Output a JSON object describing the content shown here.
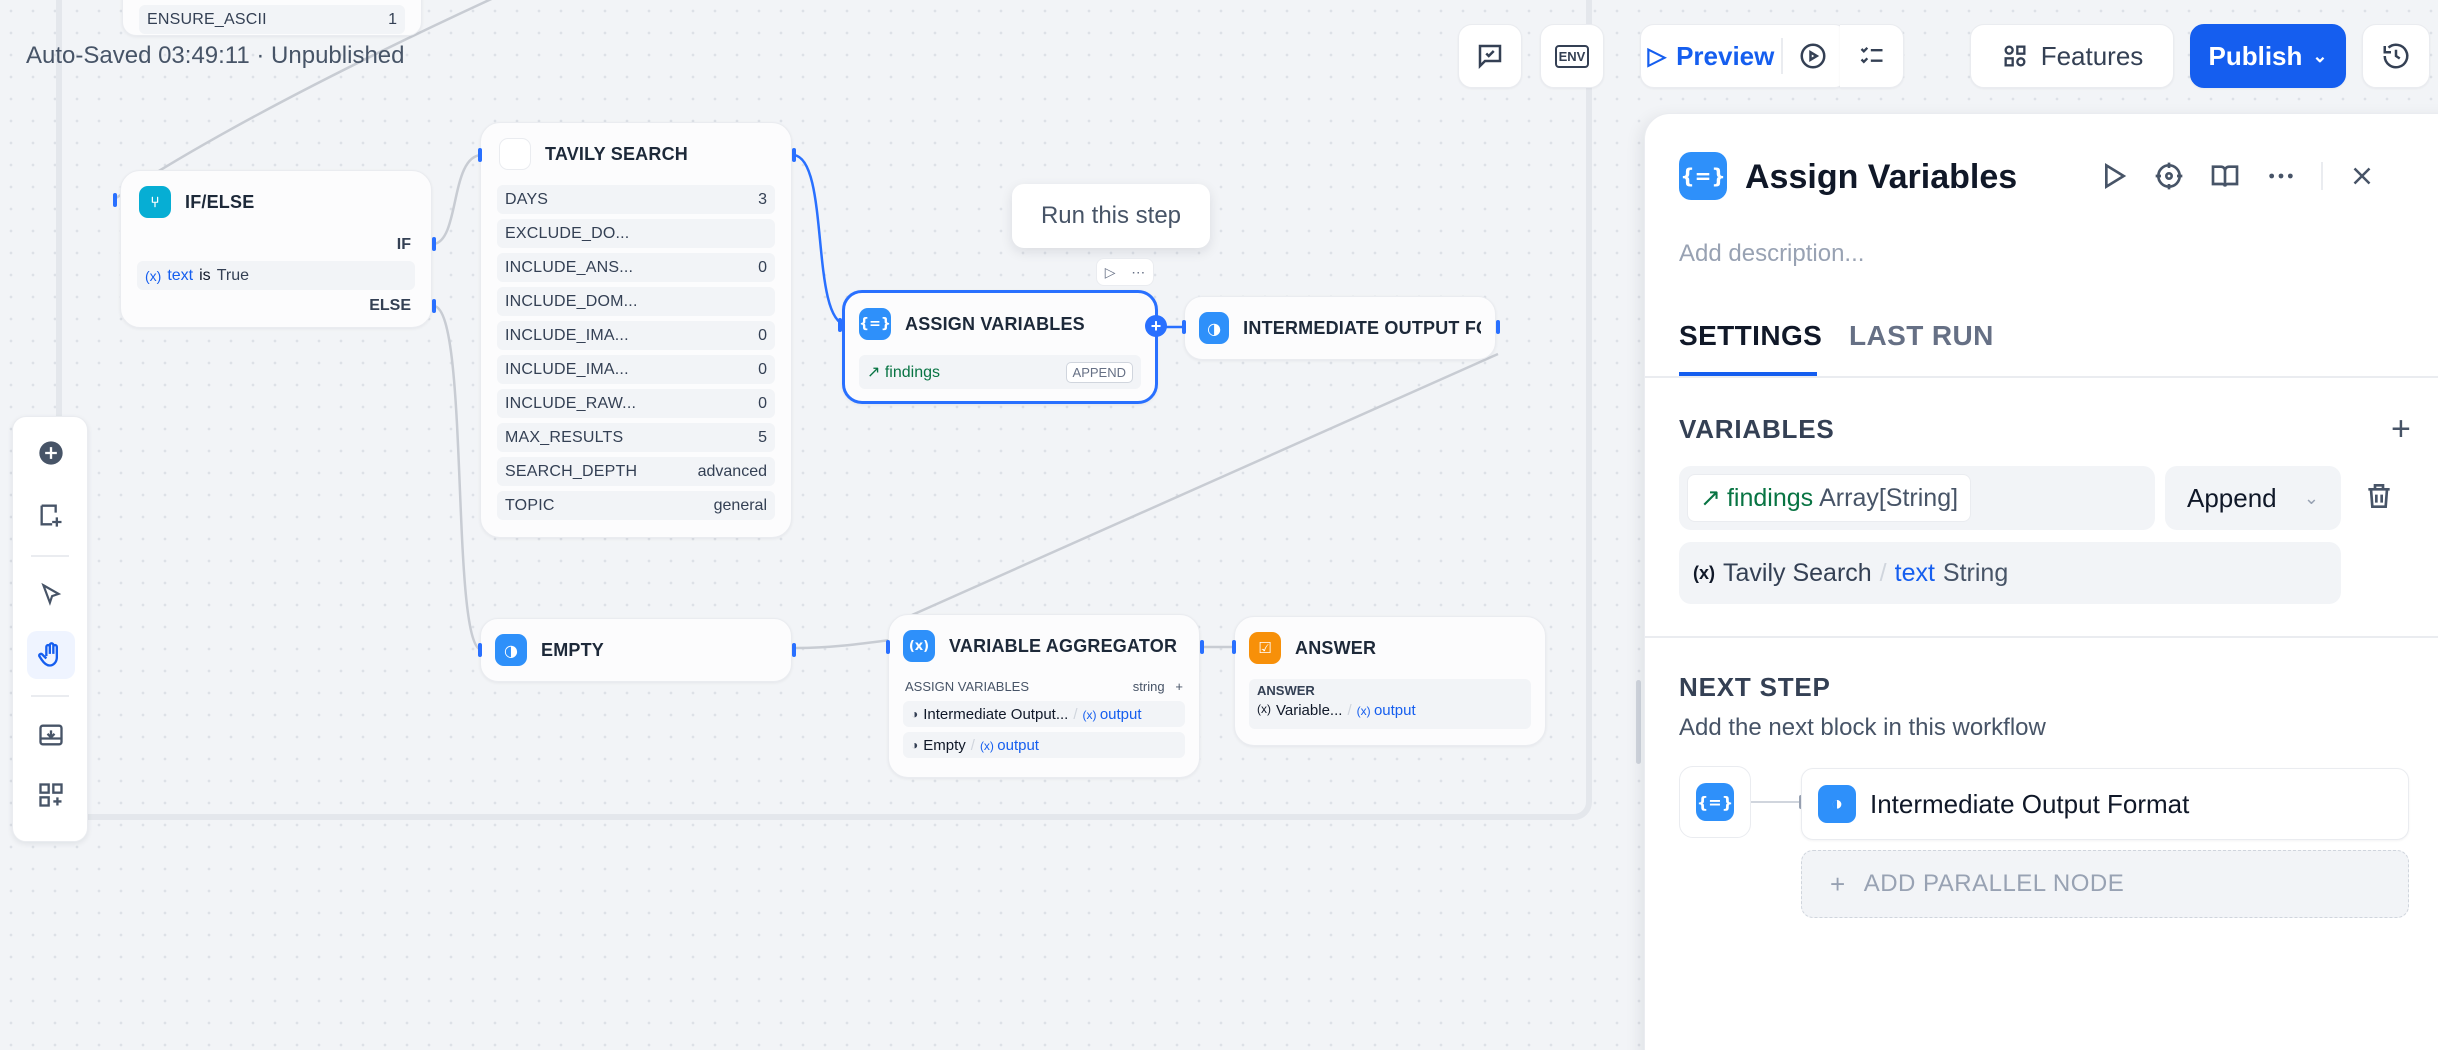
{
  "autosave": "Auto-Saved 03:49:11 · Unpublished",
  "topbar": {
    "preview": "Preview",
    "features": "Features",
    "publish": "Publish",
    "env": "ENV"
  },
  "tooltip": "Run this step",
  "nodes": {
    "top_stub": {
      "key": "ENSURE_ASCII",
      "value": "1"
    },
    "ifelse": {
      "title": "IF/ELSE",
      "if_label": "IF",
      "else_label": "ELSE",
      "cond_var": "text",
      "cond_op": "is",
      "cond_val": "True"
    },
    "tavily": {
      "title": "TAVILY SEARCH",
      "params": [
        {
          "k": "DAYS",
          "v": "3"
        },
        {
          "k": "EXCLUDE_DO...",
          "v": ""
        },
        {
          "k": "INCLUDE_ANS...",
          "v": "0"
        },
        {
          "k": "INCLUDE_DOM...",
          "v": ""
        },
        {
          "k": "INCLUDE_IMA...",
          "v": "0"
        },
        {
          "k": "INCLUDE_IMA...",
          "v": "0"
        },
        {
          "k": "INCLUDE_RAW...",
          "v": "0"
        },
        {
          "k": "MAX_RESULTS",
          "v": "5"
        },
        {
          "k": "SEARCH_DEPTH",
          "v": "advanced"
        },
        {
          "k": "TOPIC",
          "v": "general"
        }
      ]
    },
    "assign": {
      "title": "ASSIGN VARIABLES",
      "var": "findings",
      "mode": "APPEND"
    },
    "intermediate": {
      "title": "INTERMEDIATE OUTPUT FOI"
    },
    "empty": {
      "title": "EMPTY"
    },
    "aggregator": {
      "title": "VARIABLE AGGREGATOR",
      "group": "ASSIGN VARIABLES",
      "type": "string",
      "rows": [
        {
          "src": "Intermediate Output...",
          "var": "output"
        },
        {
          "src": "Empty",
          "var": "output"
        }
      ]
    },
    "answer": {
      "title": "ANSWER",
      "label": "ANSWER",
      "src": "Variable...",
      "var": "output"
    }
  },
  "panel": {
    "title": "Assign Variables",
    "description_placeholder": "Add description...",
    "tabs": [
      "SETTINGS",
      "LAST RUN"
    ],
    "variables_title": "VARIABLES",
    "var_name": "findings",
    "var_type": "Array[String]",
    "mode": "Append",
    "source_node": "Tavily Search",
    "source_var": "text",
    "source_type": "String",
    "next_title": "NEXT STEP",
    "next_desc": "Add the next block in this workflow",
    "next_block": "Intermediate Output Format",
    "add_parallel": "ADD PARALLEL NODE"
  },
  "colors": {
    "accent": "#155eef",
    "selected_border": "#2970ff",
    "ifelse_icon": "#06aed4",
    "answer_icon": "#f79009"
  }
}
